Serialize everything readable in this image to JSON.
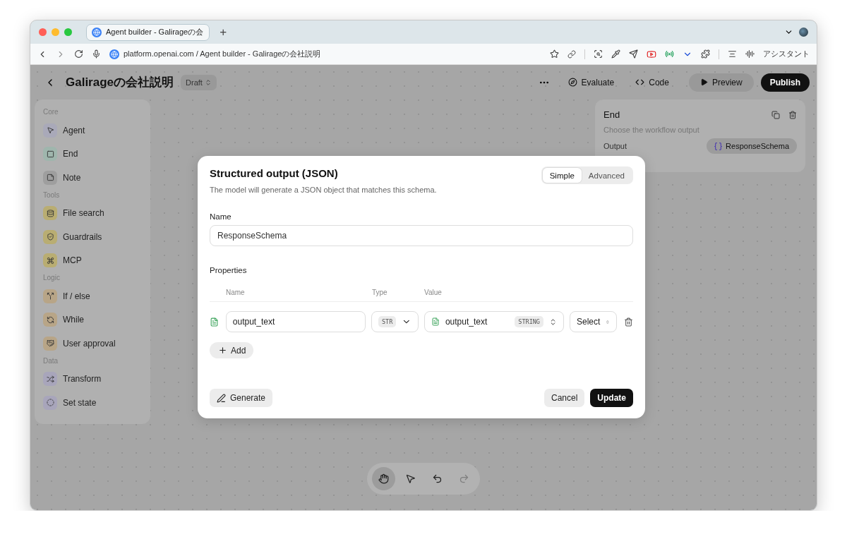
{
  "browser": {
    "tab": {
      "title": "Agent builder - Galirageの会",
      "selected": true
    },
    "new_tab": "+",
    "url": "platform.openai.com / Agent builder - Galirageの会社説明",
    "assistant": "アシスタント"
  },
  "header": {
    "title": "Galirageの会社説明",
    "status": "Draft",
    "actions": [
      {
        "kind": "evaluate",
        "label": "Evaluate"
      },
      {
        "kind": "code",
        "label": "Code"
      }
    ],
    "preview": "Preview",
    "publish": "Publish"
  },
  "sidebar": {
    "sections": [
      {
        "title": "Core",
        "items": [
          {
            "kind": "agent",
            "label": "Agent",
            "color": "#a9a9b9"
          },
          {
            "kind": "end",
            "label": "End",
            "color": "#9fb6ad"
          },
          {
            "kind": "note",
            "label": "Note",
            "color": "#9e9e9e"
          }
        ]
      },
      {
        "title": "Tools",
        "items": [
          {
            "kind": "file",
            "label": "File search",
            "color": "#b9ad72"
          },
          {
            "kind": "guard",
            "label": "Guardrails",
            "color": "#b9ad72"
          },
          {
            "kind": "mcp",
            "label": "MCP",
            "color": "#b9ad72"
          }
        ]
      },
      {
        "title": "Logic",
        "items": [
          {
            "kind": "ifelse",
            "label": "If / else",
            "color": "#b8a587"
          },
          {
            "kind": "while",
            "label": "While",
            "color": "#b8a587"
          },
          {
            "kind": "approval",
            "label": "User approval",
            "color": "#b8a587"
          }
        ]
      },
      {
        "title": "Data",
        "items": [
          {
            "kind": "transform",
            "label": "Transform",
            "color": "#a8a5bb"
          },
          {
            "kind": "state",
            "label": "Set state",
            "color": "#a8a5bb"
          }
        ]
      }
    ]
  },
  "end_node": {
    "title": "End",
    "description": "Choose the workflow output",
    "output_label": "Output",
    "output_value": "ResponseSchema"
  },
  "modal": {
    "title": "Structured output (JSON)",
    "description": "The model will generate a JSON object that matches this schema.",
    "modes": [
      {
        "label": "Simple",
        "selected": true
      },
      {
        "label": "Advanced",
        "selected": false
      }
    ],
    "name_label": "Name",
    "name_value": "ResponseSchema",
    "properties_label": "Properties",
    "columns": [
      "Name",
      "Type",
      "Value"
    ],
    "rows": [
      {
        "name": "output_text",
        "type": "STR",
        "value": "output_text",
        "value_type": "STRING",
        "select": "Select"
      }
    ],
    "add": "Add",
    "generate": "Generate",
    "cancel": "Cancel",
    "update": "Update"
  },
  "toolbar": {
    "tools": [
      {
        "kind": "hand",
        "selected": true
      },
      {
        "kind": "pointer",
        "selected": false
      }
    ],
    "history": [
      {
        "kind": "undo",
        "disabled": false
      },
      {
        "kind": "redo",
        "disabled": true
      }
    ]
  }
}
